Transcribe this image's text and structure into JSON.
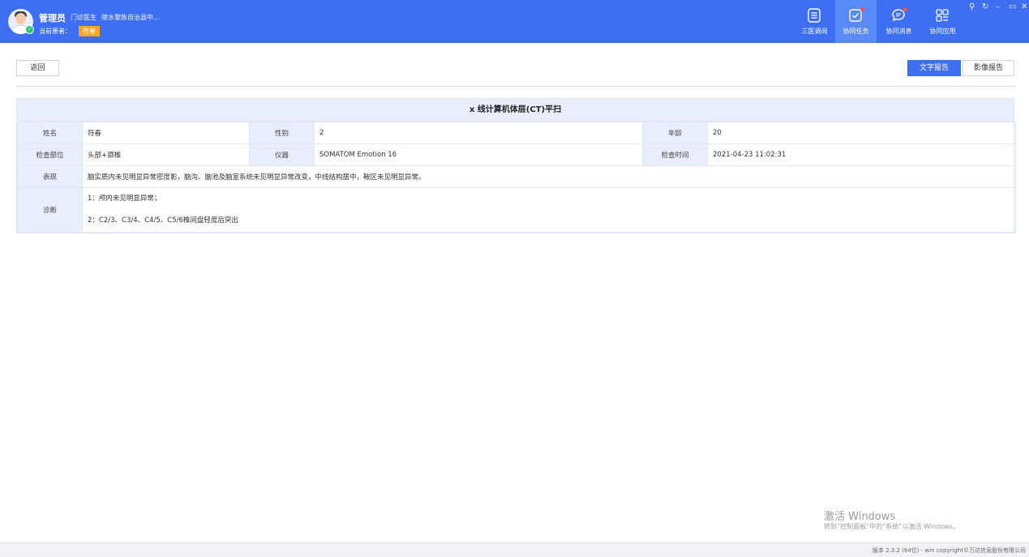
{
  "header": {
    "user_name": "管理员",
    "user_role": "门诊医生",
    "user_org": "陵水黎族自治县中...",
    "patient_label": "当前患者：",
    "patient_name": "符春",
    "nav": [
      {
        "label": "三医调阅",
        "icon": "document-list-icon"
      },
      {
        "label": "协同任务",
        "icon": "task-check-icon"
      },
      {
        "label": "协同消息",
        "icon": "chat-message-icon"
      },
      {
        "label": "协同应用",
        "icon": "apps-grid-icon"
      }
    ]
  },
  "toolbar": {
    "back_label": "返回",
    "text_report_label": "文字报告",
    "image_report_label": "影像报告"
  },
  "report": {
    "title": "x 线计算机体层(CT)平扫",
    "name_label": "姓名",
    "name_value": "符春",
    "gender_label": "性别",
    "gender_value": "2",
    "age_label": "年龄",
    "age_value": "20",
    "part_label": "检查部位",
    "part_value": "头部+颈椎",
    "device_label": "仪器",
    "device_value": "SOMATOM Emotion 16",
    "time_label": "检查时间",
    "time_value": "2021-04-23 11:02:31",
    "finding_label": "表现",
    "finding_value": "脑实质内未见明显异常密度影，脑沟、脑池及脑室系统未见明显异常改变，中线结构居中，鞍区未见明显异常。",
    "diagnosis_label": "诊断",
    "diagnosis_lines": [
      "1：颅内未见明显异常；",
      "2：C2/3、C3/4、C4/5、C5/6椎间盘轻度后突出"
    ]
  },
  "watermark": {
    "title": "激活 Windows",
    "subtitle": "转到“控制面板”中的“系统”以激活 Windows。"
  },
  "footer": {
    "text": "版本 2.3.2 (64位) - win   copyright©万达信息股份有限公司"
  }
}
